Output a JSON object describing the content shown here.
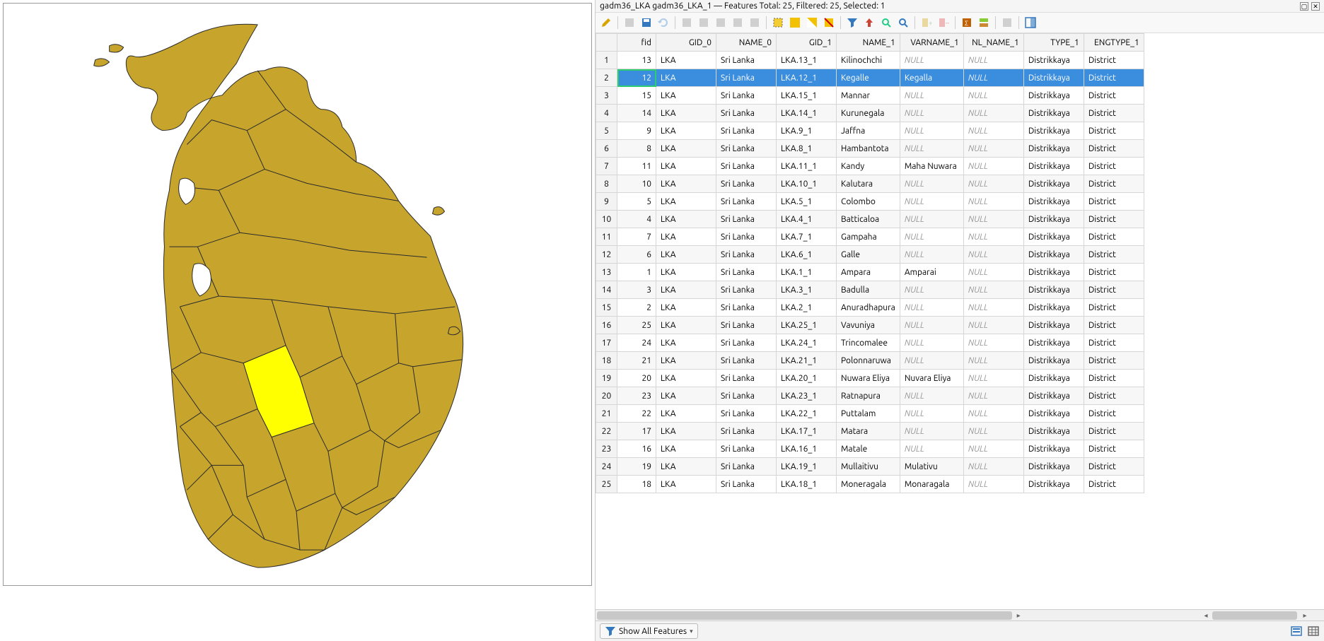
{
  "titlebar": {
    "text": "gadm36_LKA gadm36_LKA_1 — Features Total: 25, Filtered: 25, Selected: 1"
  },
  "toolbar_icons": [
    {
      "name": "pencil-icon",
      "color": "#d8a400",
      "enabled": true
    },
    {
      "name": "multi-edit-icon",
      "color": "#888",
      "enabled": false
    },
    {
      "name": "save-edits-icon",
      "color": "#3478c0",
      "enabled": true
    },
    {
      "name": "refresh-blue-icon",
      "color": "#2a7bd1",
      "enabled": false
    },
    {
      "name": "add-feature-icon",
      "color": "#888",
      "enabled": false
    },
    {
      "name": "delete-feature-icon",
      "color": "#888",
      "enabled": false
    },
    {
      "name": "cut-icon",
      "color": "#888",
      "enabled": false
    },
    {
      "name": "copy-icon",
      "color": "#888",
      "enabled": false
    },
    {
      "name": "paste-icon",
      "color": "#888",
      "enabled": false
    },
    {
      "name": "select-rect-yellow-icon",
      "color": "#f2c200",
      "enabled": true
    },
    {
      "name": "select-all-icon",
      "color": "#f2c200",
      "enabled": true
    },
    {
      "name": "invert-selection-icon",
      "color": "#f2c200",
      "enabled": true
    },
    {
      "name": "deselect-icon",
      "color": "#f2c200",
      "enabled": true
    },
    {
      "name": "filter-funnel-icon",
      "color": "#3478c0",
      "enabled": true
    },
    {
      "name": "move-up-icon",
      "color": "#c43",
      "enabled": true
    },
    {
      "name": "zoom-map-icon",
      "color": "#2c8",
      "enabled": true
    },
    {
      "name": "zoom-selected-icon",
      "color": "#3478c0",
      "enabled": true
    },
    {
      "name": "new-field-icon",
      "color": "#d0a000",
      "enabled": false
    },
    {
      "name": "delete-field-icon",
      "color": "#d44",
      "enabled": false
    },
    {
      "name": "field-calc-icon",
      "color": "#c06000",
      "enabled": true
    },
    {
      "name": "conditional-format-icon",
      "color": "#8a3",
      "enabled": true
    },
    {
      "name": "actions-icon",
      "color": "#888",
      "enabled": false
    },
    {
      "name": "dock-panel-icon",
      "color": "#3478c0",
      "enabled": true
    }
  ],
  "columns": [
    "",
    "fid",
    "GID_0",
    "NAME_0",
    "GID_1",
    "NAME_1",
    "VARNAME_1",
    "NL_NAME_1",
    "TYPE_1",
    "ENGTYPE_1"
  ],
  "rows": [
    {
      "n": 1,
      "fid": 13,
      "gid0": "LKA",
      "name0": "Sri Lanka",
      "gid1": "LKA.13_1",
      "name1": "Kilinochchi",
      "varname1": null,
      "nlname1": null,
      "type1": "Distrikkaya",
      "engtype1": "District",
      "selected": false
    },
    {
      "n": 2,
      "fid": 12,
      "gid0": "LKA",
      "name0": "Sri Lanka",
      "gid1": "LKA.12_1",
      "name1": "Kegalle",
      "varname1": "Kegalla",
      "nlname1": null,
      "type1": "Distrikkaya",
      "engtype1": "District",
      "selected": true
    },
    {
      "n": 3,
      "fid": 15,
      "gid0": "LKA",
      "name0": "Sri Lanka",
      "gid1": "LKA.15_1",
      "name1": "Mannar",
      "varname1": null,
      "nlname1": null,
      "type1": "Distrikkaya",
      "engtype1": "District",
      "selected": false
    },
    {
      "n": 4,
      "fid": 14,
      "gid0": "LKA",
      "name0": "Sri Lanka",
      "gid1": "LKA.14_1",
      "name1": "Kurunegala",
      "varname1": null,
      "nlname1": null,
      "type1": "Distrikkaya",
      "engtype1": "District",
      "selected": false
    },
    {
      "n": 5,
      "fid": 9,
      "gid0": "LKA",
      "name0": "Sri Lanka",
      "gid1": "LKA.9_1",
      "name1": "Jaffna",
      "varname1": null,
      "nlname1": null,
      "type1": "Distrikkaya",
      "engtype1": "District",
      "selected": false
    },
    {
      "n": 6,
      "fid": 8,
      "gid0": "LKA",
      "name0": "Sri Lanka",
      "gid1": "LKA.8_1",
      "name1": "Hambantota",
      "varname1": null,
      "nlname1": null,
      "type1": "Distrikkaya",
      "engtype1": "District",
      "selected": false
    },
    {
      "n": 7,
      "fid": 11,
      "gid0": "LKA",
      "name0": "Sri Lanka",
      "gid1": "LKA.11_1",
      "name1": "Kandy",
      "varname1": "Maha Nuwara",
      "nlname1": null,
      "type1": "Distrikkaya",
      "engtype1": "District",
      "selected": false
    },
    {
      "n": 8,
      "fid": 10,
      "gid0": "LKA",
      "name0": "Sri Lanka",
      "gid1": "LKA.10_1",
      "name1": "Kalutara",
      "varname1": null,
      "nlname1": null,
      "type1": "Distrikkaya",
      "engtype1": "District",
      "selected": false
    },
    {
      "n": 9,
      "fid": 5,
      "gid0": "LKA",
      "name0": "Sri Lanka",
      "gid1": "LKA.5_1",
      "name1": "Colombo",
      "varname1": null,
      "nlname1": null,
      "type1": "Distrikkaya",
      "engtype1": "District",
      "selected": false
    },
    {
      "n": 10,
      "fid": 4,
      "gid0": "LKA",
      "name0": "Sri Lanka",
      "gid1": "LKA.4_1",
      "name1": "Batticaloa",
      "varname1": null,
      "nlname1": null,
      "type1": "Distrikkaya",
      "engtype1": "District",
      "selected": false
    },
    {
      "n": 11,
      "fid": 7,
      "gid0": "LKA",
      "name0": "Sri Lanka",
      "gid1": "LKA.7_1",
      "name1": "Gampaha",
      "varname1": null,
      "nlname1": null,
      "type1": "Distrikkaya",
      "engtype1": "District",
      "selected": false
    },
    {
      "n": 12,
      "fid": 6,
      "gid0": "LKA",
      "name0": "Sri Lanka",
      "gid1": "LKA.6_1",
      "name1": "Galle",
      "varname1": null,
      "nlname1": null,
      "type1": "Distrikkaya",
      "engtype1": "District",
      "selected": false
    },
    {
      "n": 13,
      "fid": 1,
      "gid0": "LKA",
      "name0": "Sri Lanka",
      "gid1": "LKA.1_1",
      "name1": "Ampara",
      "varname1": "Amparai",
      "nlname1": null,
      "type1": "Distrikkaya",
      "engtype1": "District",
      "selected": false
    },
    {
      "n": 14,
      "fid": 3,
      "gid0": "LKA",
      "name0": "Sri Lanka",
      "gid1": "LKA.3_1",
      "name1": "Badulla",
      "varname1": null,
      "nlname1": null,
      "type1": "Distrikkaya",
      "engtype1": "District",
      "selected": false
    },
    {
      "n": 15,
      "fid": 2,
      "gid0": "LKA",
      "name0": "Sri Lanka",
      "gid1": "LKA.2_1",
      "name1": "Anuradhapura",
      "varname1": null,
      "nlname1": null,
      "type1": "Distrikkaya",
      "engtype1": "District",
      "selected": false
    },
    {
      "n": 16,
      "fid": 25,
      "gid0": "LKA",
      "name0": "Sri Lanka",
      "gid1": "LKA.25_1",
      "name1": "Vavuniya",
      "varname1": null,
      "nlname1": null,
      "type1": "Distrikkaya",
      "engtype1": "District",
      "selected": false
    },
    {
      "n": 17,
      "fid": 24,
      "gid0": "LKA",
      "name0": "Sri Lanka",
      "gid1": "LKA.24_1",
      "name1": "Trincomalee",
      "varname1": null,
      "nlname1": null,
      "type1": "Distrikkaya",
      "engtype1": "District",
      "selected": false
    },
    {
      "n": 18,
      "fid": 21,
      "gid0": "LKA",
      "name0": "Sri Lanka",
      "gid1": "LKA.21_1",
      "name1": "Polonnaruwa",
      "varname1": null,
      "nlname1": null,
      "type1": "Distrikkaya",
      "engtype1": "District",
      "selected": false
    },
    {
      "n": 19,
      "fid": 20,
      "gid0": "LKA",
      "name0": "Sri Lanka",
      "gid1": "LKA.20_1",
      "name1": "Nuwara Eliya",
      "varname1": "Nuvara Eliya",
      "nlname1": null,
      "type1": "Distrikkaya",
      "engtype1": "District",
      "selected": false
    },
    {
      "n": 20,
      "fid": 23,
      "gid0": "LKA",
      "name0": "Sri Lanka",
      "gid1": "LKA.23_1",
      "name1": "Ratnapura",
      "varname1": null,
      "nlname1": null,
      "type1": "Distrikkaya",
      "engtype1": "District",
      "selected": false
    },
    {
      "n": 21,
      "fid": 22,
      "gid0": "LKA",
      "name0": "Sri Lanka",
      "gid1": "LKA.22_1",
      "name1": "Puttalam",
      "varname1": null,
      "nlname1": null,
      "type1": "Distrikkaya",
      "engtype1": "District",
      "selected": false
    },
    {
      "n": 22,
      "fid": 17,
      "gid0": "LKA",
      "name0": "Sri Lanka",
      "gid1": "LKA.17_1",
      "name1": "Matara",
      "varname1": null,
      "nlname1": null,
      "type1": "Distrikkaya",
      "engtype1": "District",
      "selected": false
    },
    {
      "n": 23,
      "fid": 16,
      "gid0": "LKA",
      "name0": "Sri Lanka",
      "gid1": "LKA.16_1",
      "name1": "Matale",
      "varname1": null,
      "nlname1": null,
      "type1": "Distrikkaya",
      "engtype1": "District",
      "selected": false
    },
    {
      "n": 24,
      "fid": 19,
      "gid0": "LKA",
      "name0": "Sri Lanka",
      "gid1": "LKA.19_1",
      "name1": "Mullaitivu",
      "varname1": "Mulativu",
      "nlname1": null,
      "type1": "Distrikkaya",
      "engtype1": "District",
      "selected": false
    },
    {
      "n": 25,
      "fid": 18,
      "gid0": "LKA",
      "name0": "Sri Lanka",
      "gid1": "LKA.18_1",
      "name1": "Moneragala",
      "varname1": "Monaragala",
      "nlname1": null,
      "type1": "Distrikkaya",
      "engtype1": "District",
      "selected": false
    }
  ],
  "null_text": "NULL",
  "footer": {
    "show_all": "Show All Features"
  },
  "map": {
    "fill": "#c7a52d",
    "stroke": "#2b2b2b",
    "highlight": "#ffff00"
  }
}
